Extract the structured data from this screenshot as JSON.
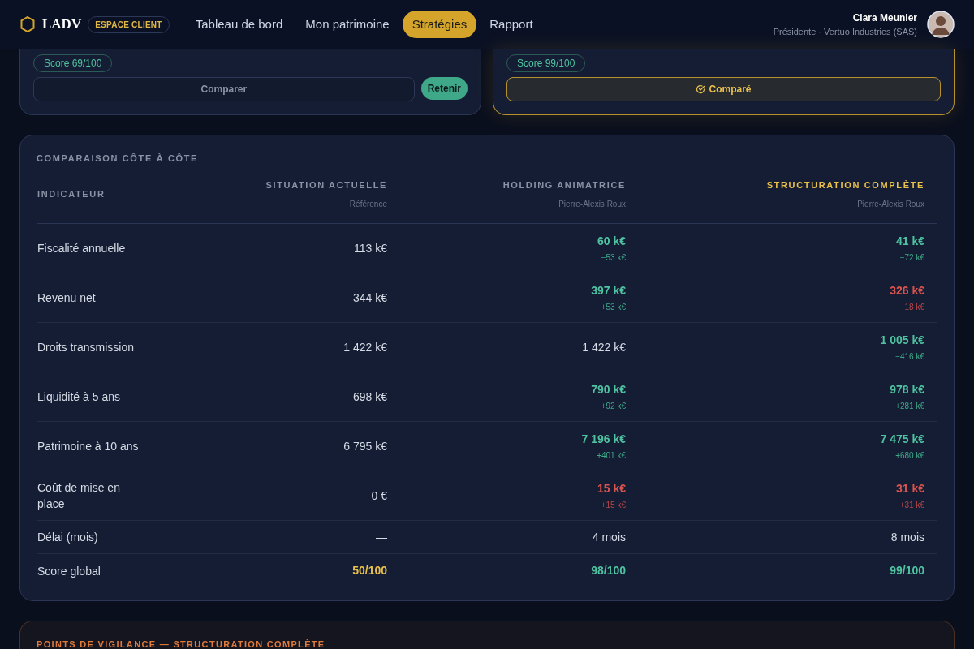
{
  "header": {
    "logo": "LADV",
    "badge": "ESPACE CLIENT",
    "nav": [
      {
        "label": "Tableau de bord",
        "selected": false
      },
      {
        "label": "Mon patrimoine",
        "selected": false
      },
      {
        "label": "Stratégies",
        "selected": true
      },
      {
        "label": "Rapport",
        "selected": false
      }
    ],
    "user": {
      "name": "Clara Meunier",
      "role": "Présidente · Vertuo Industries (SAS)"
    }
  },
  "strategy_cards": [
    {
      "score": "Score 69/100",
      "compare_label": "Comparer",
      "compared": false,
      "retain_label": "Retenir"
    },
    {
      "score": "Score 99/100",
      "compare_label": "Comparé",
      "compared": true
    }
  ],
  "comparison": {
    "title": "COMPARAISON CÔTE À CÔTE",
    "columns": [
      {
        "label": "INDICATEUR"
      },
      {
        "label": "SITUATION ACTUELLE",
        "subtitle": "Référence",
        "highlighted": false
      },
      {
        "label": "HOLDING ANIMATRICE",
        "subtitle": "Pierre-Alexis Roux",
        "highlighted": false
      },
      {
        "label": "STRUCTURATION COMPLÈTE",
        "subtitle": "Pierre-Alexis Roux",
        "highlighted": true
      }
    ],
    "rows": [
      {
        "cells": [
          {
            "value": "Fiscalité annuelle",
            "kind": "label"
          },
          {
            "value": "113 k€",
            "kind": "neutral"
          },
          {
            "value": "60 k€",
            "delta": "−53 k€",
            "kind": "good"
          },
          {
            "value": "41 k€",
            "delta": "−72 k€",
            "kind": "good"
          }
        ]
      },
      {
        "cells": [
          {
            "value": "Revenu net",
            "kind": "label"
          },
          {
            "value": "344 k€",
            "kind": "neutral"
          },
          {
            "value": "397 k€",
            "delta": "+53 k€",
            "kind": "good"
          },
          {
            "value": "326 k€",
            "delta": "−18 k€",
            "kind": "bad"
          }
        ]
      },
      {
        "cells": [
          {
            "value": "Droits transmission",
            "kind": "label"
          },
          {
            "value": "1 422 k€",
            "kind": "neutral"
          },
          {
            "value": "1 422 k€",
            "kind": "neutral"
          },
          {
            "value": "1 005 k€",
            "delta": "−416 k€",
            "kind": "good"
          }
        ]
      },
      {
        "cells": [
          {
            "value": "Liquidité à 5 ans",
            "kind": "label"
          },
          {
            "value": "698 k€",
            "kind": "neutral"
          },
          {
            "value": "790 k€",
            "delta": "+92 k€",
            "kind": "good"
          },
          {
            "value": "978 k€",
            "delta": "+281 k€",
            "kind": "good"
          }
        ]
      },
      {
        "cells": [
          {
            "value": "Patrimoine à 10 ans",
            "kind": "label"
          },
          {
            "value": "6 795 k€",
            "kind": "neutral"
          },
          {
            "value": "7 196 k€",
            "delta": "+401 k€",
            "kind": "good"
          },
          {
            "value": "7 475 k€",
            "delta": "+680 k€",
            "kind": "good"
          }
        ]
      },
      {
        "cells": [
          {
            "value": "Coût de mise en place",
            "kind": "label"
          },
          {
            "value": "0 €",
            "kind": "neutral"
          },
          {
            "value": "15 k€",
            "delta": "+15 k€",
            "kind": "bad"
          },
          {
            "value": "31 k€",
            "delta": "+31 k€",
            "kind": "bad"
          }
        ]
      },
      {
        "cells": [
          {
            "value": "Délai (mois)",
            "kind": "label"
          },
          {
            "value": "—",
            "kind": "neutral"
          },
          {
            "value": "4 mois",
            "kind": "neutral"
          },
          {
            "value": "8 mois",
            "kind": "neutral"
          }
        ]
      },
      {
        "cells": [
          {
            "value": "Score global",
            "kind": "label"
          },
          {
            "value": "50/100",
            "kind": "warn"
          },
          {
            "value": "98/100",
            "kind": "good"
          },
          {
            "value": "99/100",
            "kind": "good"
          }
        ]
      }
    ]
  },
  "vigilance": {
    "title": "POINTS DE VIGILANCE — STRUCTURATION COMPLÈTE"
  }
}
